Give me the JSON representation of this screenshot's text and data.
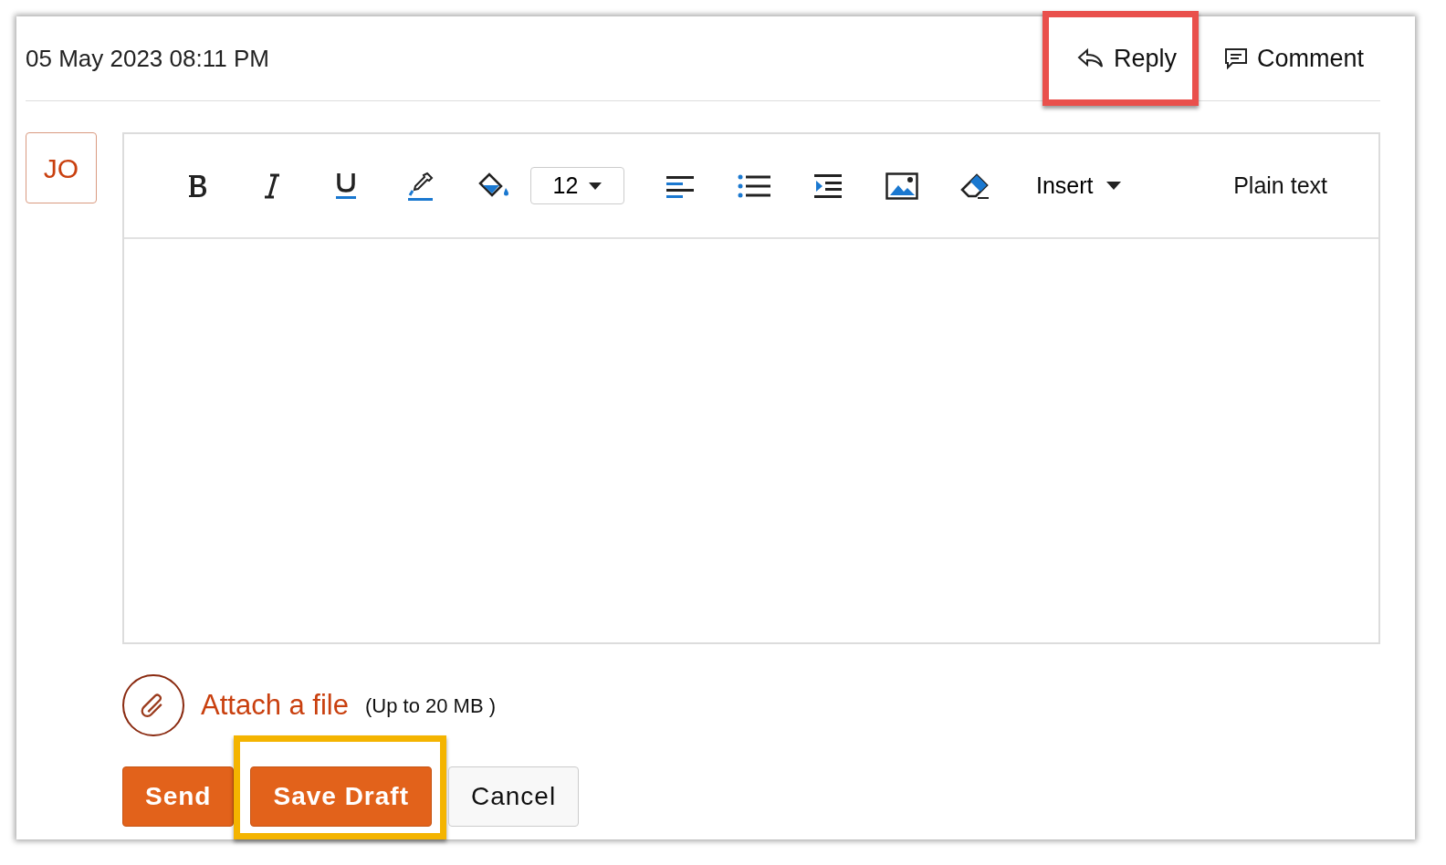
{
  "header": {
    "date": "05 May 2023 08:11 PM",
    "actions": [
      {
        "label": "Reply",
        "kind": "reply",
        "highlight": {
          "color": "#e9504c"
        }
      },
      {
        "label": "Comment",
        "kind": "comment"
      }
    ]
  },
  "avatar": {
    "initials": "JO"
  },
  "toolbar": {
    "font_size": "12",
    "insert_label": "Insert",
    "mode_link": "Plain text"
  },
  "attachment": {
    "label": "Attach a file",
    "note": "(Up to 20 MB )"
  },
  "buttons": [
    {
      "label": "Send",
      "kind": "primary"
    },
    {
      "label": "Save Draft",
      "kind": "primary",
      "highlight": {
        "color": "#f4b400"
      }
    },
    {
      "label": "Cancel",
      "kind": "secondary"
    }
  ]
}
